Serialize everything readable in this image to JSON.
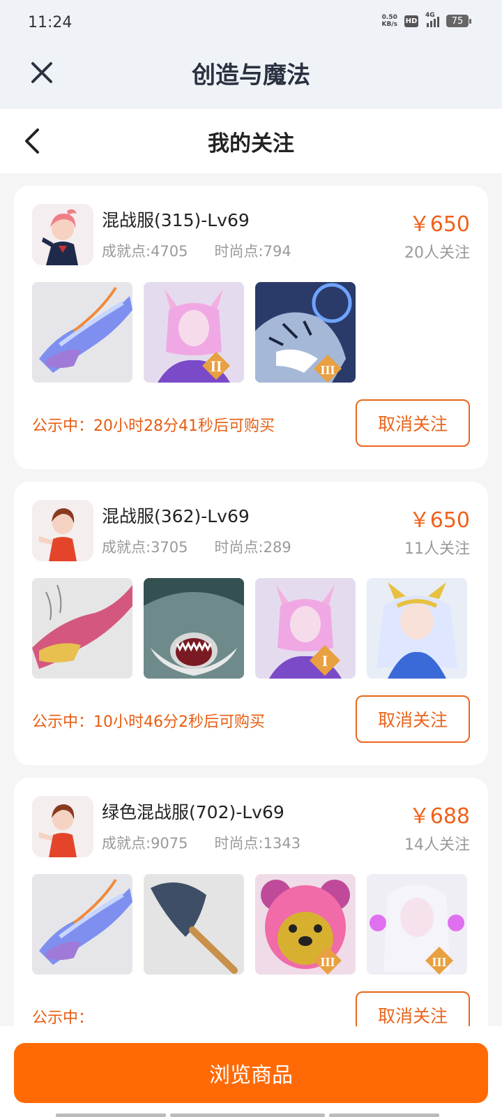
{
  "status": {
    "time": "11:24",
    "netspeed_value": "0.50",
    "netspeed_unit": "KB/s",
    "hd": "HD",
    "network": "4G",
    "battery": "75"
  },
  "header": {
    "title": "创造与魔法"
  },
  "subheader": {
    "title": "我的关注"
  },
  "items": [
    {
      "name": "混战服(315)-Lv69",
      "achievement": "成就点:4705",
      "fashion": "时尚点:794",
      "price": "￥650",
      "followers": "20人关注",
      "notice": "公示中：20小时28分41秒后可购买",
      "button": "取消关注",
      "thumbs": [
        "dragon-blue",
        "fox-girl-II",
        "tiger-III"
      ]
    },
    {
      "name": "混战服(362)-Lv69",
      "achievement": "成就点:3705",
      "fashion": "时尚点:289",
      "price": "￥650",
      "followers": "11人关注",
      "notice": "公示中：10小时46分2秒后可购买",
      "button": "取消关注",
      "thumbs": [
        "dragon-red",
        "shark",
        "fox-girl-I",
        "valkyrie"
      ]
    },
    {
      "name": "绿色混战服(702)-Lv69",
      "achievement": "成就点:9075",
      "fashion": "时尚点:1343",
      "price": "￥688",
      "followers": "14人关注",
      "notice": "公示中：",
      "button": "取消关注",
      "thumbs": [
        "dragon-blue",
        "shovel",
        "bear-III",
        "snow-girl-III"
      ]
    }
  ],
  "footer": {
    "browse_label": "浏览商品"
  },
  "colors": {
    "accent": "#ff6a06",
    "price": "#f0611a",
    "notice": "#e85c10"
  }
}
